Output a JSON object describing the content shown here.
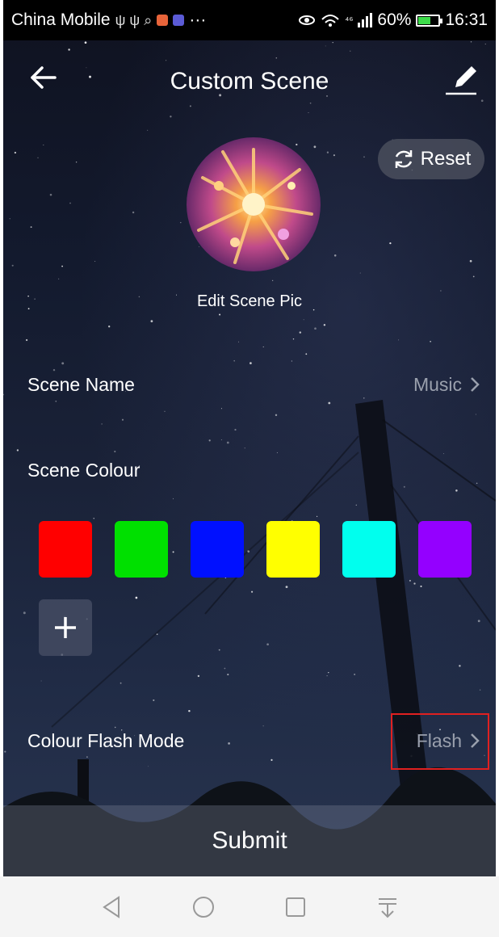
{
  "status_bar": {
    "carrier": "China Mobile",
    "left_glyphs": "ψ ψ ⌕",
    "dots": "···",
    "network": "⁴⁶",
    "battery": "60%",
    "battery_level": 0.6,
    "time": "16:31"
  },
  "header": {
    "title": "Custom Scene",
    "back_icon": "back-arrow-icon",
    "edit_icon": "edit-pencil-icon"
  },
  "reset": {
    "label": "Reset",
    "icon": "refresh-icon"
  },
  "scene_pic": {
    "label": "Edit Scene Pic"
  },
  "scene_name": {
    "label": "Scene Name",
    "value": "Music"
  },
  "scene_colour": {
    "label": "Scene Colour",
    "colours": [
      "#ff0000",
      "#00e000",
      "#0010ff",
      "#ffff00",
      "#00ffee",
      "#9400ff"
    ],
    "add_icon": "plus-icon"
  },
  "flash_mode": {
    "label": "Colour Flash Mode",
    "value": "Flash"
  },
  "submit": {
    "label": "Submit"
  },
  "nav": [
    "back-triangle-icon",
    "home-circle-icon",
    "recents-square-icon",
    "notification-pulldown-icon"
  ]
}
